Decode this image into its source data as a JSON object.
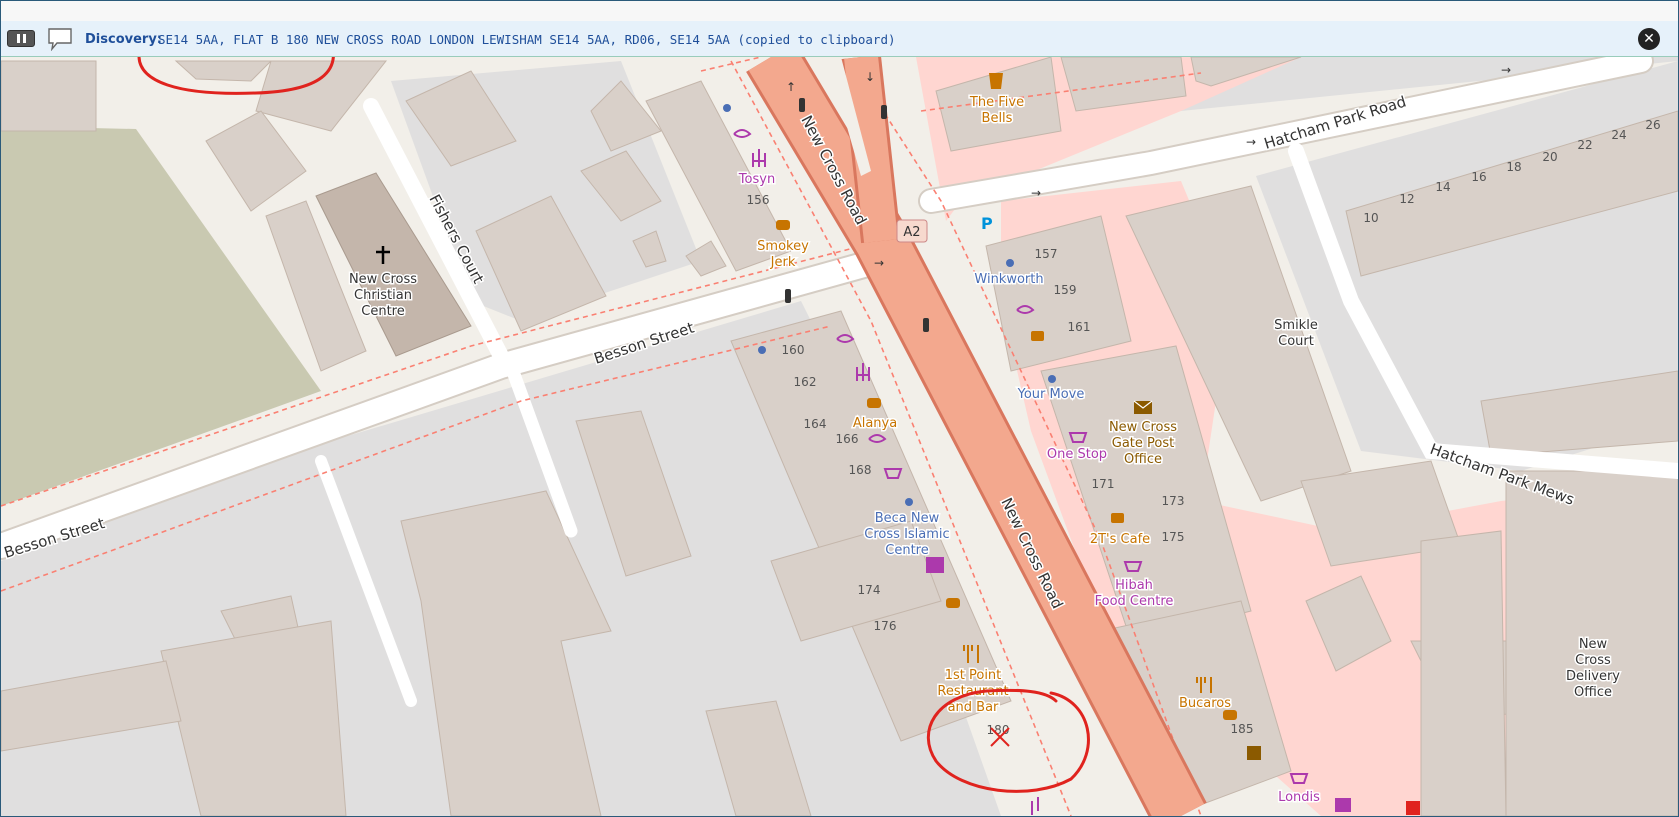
{
  "discovery": {
    "label": "Discovery:",
    "text": "SE14 5AA, FLAT B 180 NEW CROSS ROAD LONDON LEWISHAM SE14 5AA, RD06, SE14 5AA (copied to clipboard)",
    "close_icon": "close-icon",
    "pause_icon": "pause-icon",
    "speech_icon": "speech-bubble-icon"
  },
  "map": {
    "streets": {
      "new_cross_road_north": "New Cross Road",
      "new_cross_road_south": "New Cross Road",
      "road_ref": "A2",
      "hatcham_park_road": "Hatcham Park Road",
      "hatcham_park_mews": "Hatcham Park Mews",
      "besson_street_mid": "Besson Street",
      "besson_street_west": "Besson Street",
      "fishers_court": "Fishers Court"
    },
    "places": {
      "five_bells": "The Five\nBells",
      "tosyn": "Tosyn",
      "smokey_jerk": "Smokey\nJerk",
      "winkworth": "Winkworth",
      "your_move": "Your Move",
      "new_cross_christian_centre": "New Cross\nChristian\nCentre",
      "smikle_court": "Smikle\nCourt",
      "alanya": "Alanya",
      "post_office": "New Cross\nGate Post\nOffice",
      "one_stop": "One Stop",
      "two_ts_cafe": "2T's Cafe",
      "hibah": "Hibah\nFood Centre",
      "beca": "Beca New\nCross Islamic\nCentre",
      "first_point": "1st Point\nRestaurant\nand Bar",
      "bucaros": "Bucaros",
      "londis": "Londis",
      "delivery_office": "New\nCross\nDelivery\nOffice"
    },
    "house_numbers": {
      "n156": "156",
      "n157": "157",
      "n159": "159",
      "n160": "160",
      "n161": "161",
      "n162": "162",
      "n164": "164",
      "n166": "166",
      "n168": "168",
      "n171": "171",
      "n173": "173",
      "n174": "174",
      "n175": "175",
      "n176": "176",
      "n180": "180",
      "n185": "185",
      "n10": "10",
      "n12": "12",
      "n14": "14",
      "n16": "16",
      "n18": "18",
      "n20": "20",
      "n22": "22",
      "n24": "24",
      "n26": "26"
    },
    "colors": {
      "background": "#f2efe9",
      "building": "#d9d0c9",
      "building_stroke": "#c4b6ab",
      "landuse": "#e0dfdf",
      "park": "#c9c9b1",
      "retail": "#ffd6d1",
      "primary_road": "#f3a88e",
      "primary_road_casing": "#d9775e",
      "footway": "#fa8072",
      "annotation": "#e0231e"
    }
  }
}
